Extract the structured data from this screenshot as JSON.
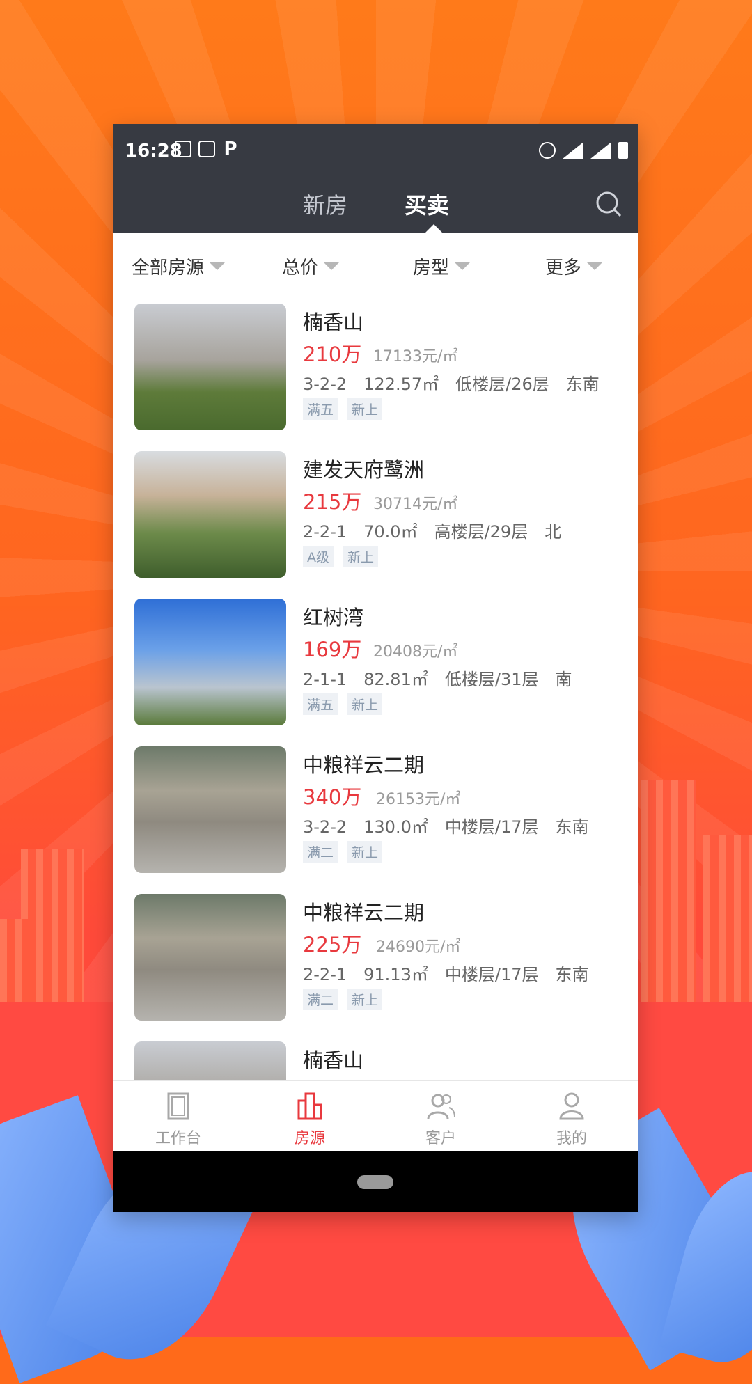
{
  "colors": {
    "accent_red": "#e8393e",
    "header_dark": "#373a42",
    "tag_text": "#8a9aad"
  },
  "status_bar": {
    "time": "16:28",
    "icons_left": [
      "vibrate-icon",
      "image-icon",
      "parking-icon"
    ],
    "icons_right": [
      "alarm-icon",
      "wifi-icon",
      "signal-3g-icon",
      "battery-icon"
    ]
  },
  "top_nav": {
    "tabs": [
      {
        "label": "新房",
        "active": false
      },
      {
        "label": "买卖",
        "active": true
      }
    ],
    "search_icon": "search-icon"
  },
  "filters": [
    "全部房源",
    "总价",
    "房型",
    "更多"
  ],
  "listings": [
    {
      "name": "楠香山",
      "price": "210万",
      "unit_price": "17133元/㎡",
      "layout": "3-2-2",
      "area": "122.57㎡",
      "floor": "低楼层/26层",
      "orientation": "东南",
      "tags": [
        "满五",
        "新上"
      ]
    },
    {
      "name": "建发天府鹭洲",
      "price": "215万",
      "unit_price": "30714元/㎡",
      "layout": "2-2-1",
      "area": "70.0㎡",
      "floor": "高楼层/29层",
      "orientation": "北",
      "tags": [
        "A级",
        "新上"
      ]
    },
    {
      "name": "红树湾",
      "price": "169万",
      "unit_price": "20408元/㎡",
      "layout": "2-1-1",
      "area": "82.81㎡",
      "floor": "低楼层/31层",
      "orientation": "南",
      "tags": [
        "满五",
        "新上"
      ]
    },
    {
      "name": "中粮祥云二期",
      "price": "340万",
      "unit_price": "26153元/㎡",
      "layout": "3-2-2",
      "area": "130.0㎡",
      "floor": "中楼层/17层",
      "orientation": "东南",
      "tags": [
        "满二",
        "新上"
      ]
    },
    {
      "name": "中粮祥云二期",
      "price": "225万",
      "unit_price": "24690元/㎡",
      "layout": "2-2-1",
      "area": "91.13㎡",
      "floor": "中楼层/17层",
      "orientation": "东南",
      "tags": [
        "满二",
        "新上"
      ]
    },
    {
      "name": "楠香山"
    }
  ],
  "bottom_nav": [
    {
      "label": "工作台",
      "icon": "door-icon",
      "active": false
    },
    {
      "label": "房源",
      "icon": "building-icon",
      "active": true
    },
    {
      "label": "客户",
      "icon": "customers-icon",
      "active": false
    },
    {
      "label": "我的",
      "icon": "profile-icon",
      "active": false
    }
  ]
}
